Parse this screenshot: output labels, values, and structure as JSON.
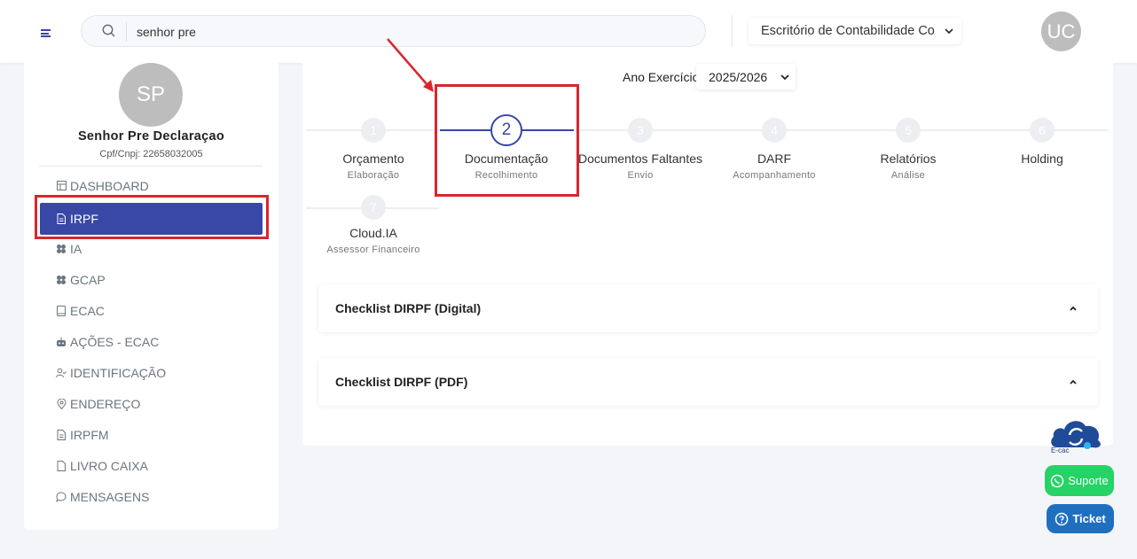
{
  "search": {
    "value": "senhor pre"
  },
  "office": {
    "selected": "Escritório de Contabilidade Co"
  },
  "user": {
    "initials": "UC"
  },
  "client": {
    "initials": "SP",
    "name": "Senhor Pre Declaraçao",
    "cpf": "Cpf/Cnpj: 22658032005"
  },
  "sidebar": {
    "items": [
      {
        "label": "DASHBOARD",
        "icon": "dashboard-icon"
      },
      {
        "label": "IRPF",
        "icon": "document-icon"
      },
      {
        "label": "IA",
        "icon": "cluster-icon"
      },
      {
        "label": "GCAP",
        "icon": "cluster-icon"
      },
      {
        "label": "ECAC",
        "icon": "book-icon"
      },
      {
        "label": "AÇÕES - ECAC",
        "icon": "robot-icon"
      },
      {
        "label": "IDENTIFICAÇÃO",
        "icon": "user-check-icon"
      },
      {
        "label": "ENDEREÇO",
        "icon": "location-pin-icon"
      },
      {
        "label": "IRPFM",
        "icon": "document-icon"
      },
      {
        "label": "LIVRO CAIXA",
        "icon": "file-icon"
      },
      {
        "label": "MENSAGENS",
        "icon": "chat-icon"
      }
    ]
  },
  "year": {
    "label": "Ano Exercício",
    "selected": "2025/2026"
  },
  "steps": [
    {
      "num": "1",
      "title": "Orçamento",
      "sub": "Elaboração"
    },
    {
      "num": "2",
      "title": "Documentação",
      "sub": "Recolhimento"
    },
    {
      "num": "3",
      "title": "Documentos Faltantes",
      "sub": "Envio"
    },
    {
      "num": "4",
      "title": "DARF",
      "sub": "Acompanhamento"
    },
    {
      "num": "5",
      "title": "Relatórios",
      "sub": "Análise"
    },
    {
      "num": "6",
      "title": "Holding",
      "sub": ""
    },
    {
      "num": "7",
      "title": "Cloud.IA",
      "sub": "Assessor Financeiro"
    }
  ],
  "accordions": [
    {
      "label": "Checklist DIRPF (Digital)"
    },
    {
      "label": "Checklist DIRPF (PDF)"
    }
  ],
  "floating": {
    "ecac_label": "E-cac",
    "suporte_label": "Suporte",
    "ticket_label": "Ticket"
  },
  "colors": {
    "primary": "#3947a7",
    "highlight": "#d9262c",
    "whatsapp": "#25d366",
    "ticket": "#1e6fbf"
  }
}
